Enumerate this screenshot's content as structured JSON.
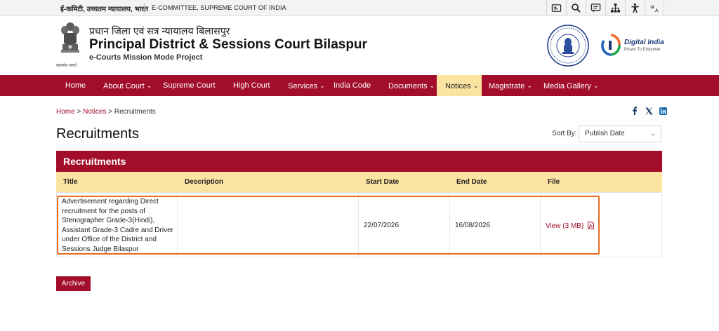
{
  "topbar": {
    "hindi_ministry": "ई-कमिटी, उच्चतम न्यायालय, भारत",
    "ecommittee": "E-COMMITTEE, SUPREME COURT OF INDIA"
  },
  "utility_icons": [
    "screen-reader-icon",
    "search-icon",
    "feedback-icon",
    "sitemap-icon",
    "accessibility-icon",
    "language-icon"
  ],
  "header": {
    "hindi_title": "प्रधान जिला एवं सत्र न्यायालय बिलासपुर",
    "title": "Principal District & Sessions Court Bilaspur",
    "subtitle": "e-Courts Mission Mode Project",
    "emblem_caption": "सत्यमेव जयते",
    "digital_india": "Digital India",
    "digital_india_tag": "Power To Empower"
  },
  "nav": {
    "items": [
      {
        "label": "Home",
        "has_dropdown": false
      },
      {
        "label": "About Court",
        "has_dropdown": true
      },
      {
        "label": "Supreme Court",
        "has_dropdown": false
      },
      {
        "label": "High Court",
        "has_dropdown": false
      },
      {
        "label": "Services",
        "has_dropdown": true
      },
      {
        "label": "India Code",
        "has_dropdown": false
      },
      {
        "label": "Documents",
        "has_dropdown": true
      },
      {
        "label": "Notices",
        "has_dropdown": true,
        "active": true
      },
      {
        "label": "Magistrate",
        "has_dropdown": true
      },
      {
        "label": "Media Gallery",
        "has_dropdown": true
      }
    ]
  },
  "breadcrumb": {
    "home": "Home",
    "notices": "Notices",
    "current": "Recruitments",
    "separator": ">"
  },
  "share_icons": [
    "facebook-icon",
    "x-icon",
    "linkedin-icon"
  ],
  "page_title": "Recruitments",
  "sort": {
    "label": "Sort By:",
    "selected": "Publish Date"
  },
  "table": {
    "caption": "Recruitments",
    "headers": {
      "title": "Title",
      "description": "Description",
      "start_date": "Start Date",
      "end_date": "End Date",
      "file": "File"
    },
    "rows": [
      {
        "title": "Advertisement regarding Direct recruitment for the posts of Stenographer Grade-3(Hindi), Assistant Grade-3 Cadre and Driver under Office of the District and Sessions Judge Bilaspur",
        "description": "",
        "start_date": "22/07/2026",
        "end_date": "16/08/2026",
        "file_label": "View (3 MB)"
      }
    ]
  },
  "archive_label": "Archive",
  "colors": {
    "brand": "#a10d2a",
    "accent": "#fbe3a2",
    "highlight": "#e86d1f"
  }
}
